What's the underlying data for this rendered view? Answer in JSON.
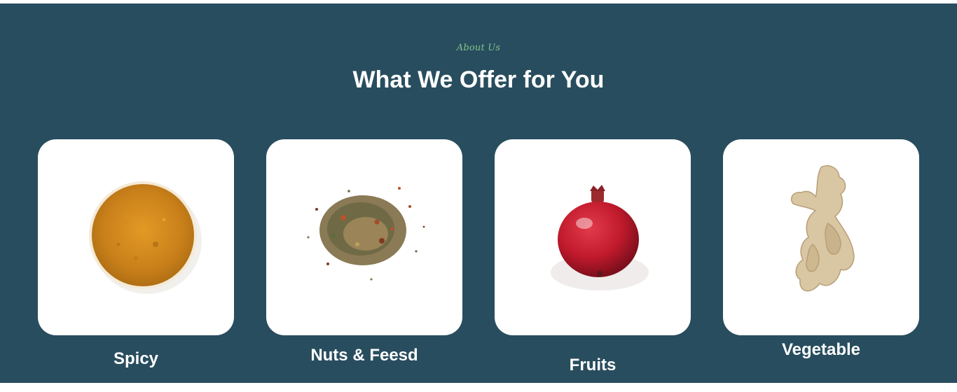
{
  "section": {
    "eyebrow": "About Us",
    "title": "What We Offer for You"
  },
  "categories": [
    {
      "label": "Spicy",
      "image": "turmeric-bowl-image"
    },
    {
      "label": "Nuts & Feesd",
      "image": "herb-mix-image"
    },
    {
      "label": "Fruits",
      "image": "pomegranate-image"
    },
    {
      "label": "Vegetable",
      "image": "ginger-root-image"
    }
  ],
  "colors": {
    "background": "#284d5e",
    "eyebrow": "#7fc48a",
    "text": "#ffffff",
    "card": "#ffffff"
  }
}
